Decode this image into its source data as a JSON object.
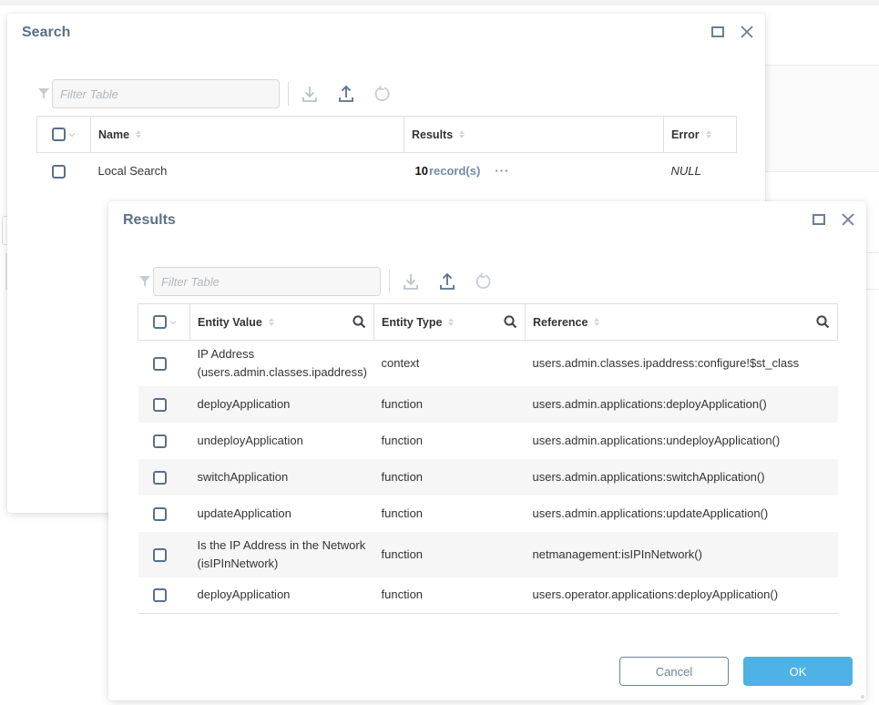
{
  "search_dialog": {
    "title": "Search",
    "filter_placeholder": "Filter Table",
    "icons": {
      "filter": "filter-icon",
      "download": "download-icon",
      "upload": "upload-icon",
      "refresh": "refresh-icon",
      "maximize": "maximize-icon",
      "close": "close-icon"
    },
    "columns": [
      "Name",
      "Results",
      "Error"
    ],
    "rows": [
      {
        "name": "Local Search",
        "results_count": "10",
        "results_label": "record(s)",
        "more": "···",
        "error": "NULL"
      }
    ]
  },
  "results_dialog": {
    "title": "Results",
    "filter_placeholder": "Filter Table",
    "columns": [
      "Entity Value",
      "Entity Type",
      "Reference"
    ],
    "rows": [
      {
        "value_line1": "IP Address",
        "value_line2": "(users.admin.classes.ipaddress)",
        "type": "context",
        "reference": "users.admin.classes.ipaddress:configure!$st_class"
      },
      {
        "value_line1": "deployApplication",
        "value_line2": "",
        "type": "function",
        "reference": "users.admin.applications:deployApplication()"
      },
      {
        "value_line1": "undeployApplication",
        "value_line2": "",
        "type": "function",
        "reference": "users.admin.applications:undeployApplication()"
      },
      {
        "value_line1": "switchApplication",
        "value_line2": "",
        "type": "function",
        "reference": "users.admin.applications:switchApplication()"
      },
      {
        "value_line1": "updateApplication",
        "value_line2": "",
        "type": "function",
        "reference": "users.admin.applications:updateApplication()"
      },
      {
        "value_line1": "Is the IP Address in the Network",
        "value_line2": "(isIPInNetwork)",
        "type": "function",
        "reference": "netmanagement:isIPInNetwork()"
      },
      {
        "value_line1": "deployApplication",
        "value_line2": "",
        "type": "function",
        "reference": "users.operator.applications:deployApplication()"
      }
    ],
    "buttons": {
      "cancel": "Cancel",
      "ok": "OK"
    }
  },
  "colors": {
    "title": "#5a7087",
    "accent": "#4eb2e4",
    "link": "#6f8aa6",
    "checkbox": "#5a7087"
  }
}
